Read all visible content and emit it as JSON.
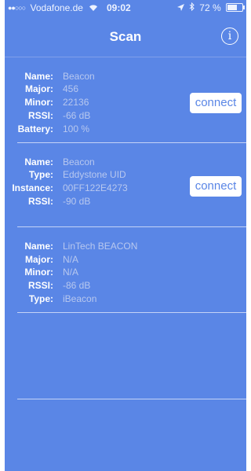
{
  "status": {
    "signal_dots": "●●○○○",
    "carrier": "Vodafone.de",
    "time": "09:02",
    "battery": "72 %",
    "battery_level": 0.72
  },
  "nav": {
    "title": "Scan",
    "info_icon": "info-circle-icon",
    "info_glyph": "i"
  },
  "devices": [
    {
      "fields": [
        {
          "label": "Name:",
          "value": "Beacon"
        },
        {
          "label": "Major:",
          "value": "456"
        },
        {
          "label": "Minor:",
          "value": "22136"
        },
        {
          "label": "RSSI:",
          "value": "-66 dB"
        },
        {
          "label": "Battery:",
          "value": "100 %"
        }
      ],
      "connect_label": "connect"
    },
    {
      "fields": [
        {
          "label": "Name:",
          "value": "Beacon"
        },
        {
          "label": "Type:",
          "value": "Eddystone UID"
        },
        {
          "label": "Instance:",
          "value": "00FF122E4273"
        },
        {
          "label": "RSSI:",
          "value": "-90 dB"
        }
      ],
      "connect_label": "connect"
    },
    {
      "fields": [
        {
          "label": "Name:",
          "value": "LinTech BEACON"
        },
        {
          "label": "Major:",
          "value": "N/A"
        },
        {
          "label": "Minor:",
          "value": "N/A"
        },
        {
          "label": "RSSI:",
          "value": "-86 dB"
        },
        {
          "label": "Type:",
          "value": "iBeacon"
        }
      ]
    },
    {
      "fields": []
    }
  ],
  "colors": {
    "background": "#5a86e6",
    "label": "#ffffff",
    "value": "#b8c8ef",
    "button_text": "#5a86e6"
  }
}
